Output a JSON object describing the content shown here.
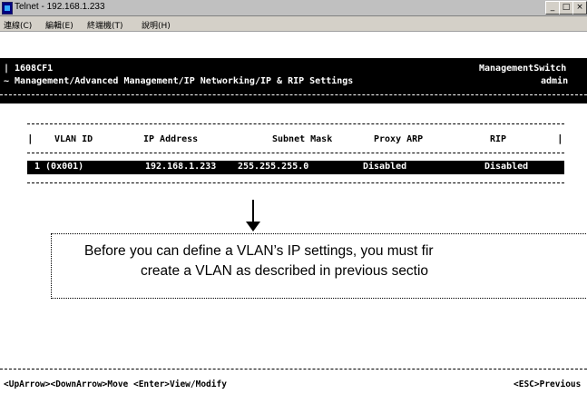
{
  "window": {
    "title": "Telnet - 192.168.1.233",
    "buttons": [
      "_",
      "□",
      "×"
    ]
  },
  "menu": {
    "items": [
      "連線(C)",
      "編輯(E)",
      "終端機(T)",
      "說明(H)"
    ]
  },
  "terminal": {
    "device": "1608CF1",
    "device_type": "ManagementSwitch",
    "breadcrumb": "~ Management/Advanced Management/IP Networking/IP & RIP Settings",
    "user": "admin",
    "columns": [
      "VLAN ID",
      "IP Address",
      "Subnet Mask",
      "Proxy ARP",
      "RIP"
    ],
    "rows": [
      {
        "vlan_id": "1 (0x001)",
        "ip_address": "192.168.1.233",
        "subnet_mask": "255.255.255.0",
        "proxy_arp": "Disabled",
        "rip": "Disabled"
      }
    ],
    "footer_left": "<UpArrow><DownArrow>Move <Enter>View/Modify",
    "footer_right": "<ESC>Previous"
  },
  "callout": {
    "line1": "Before you can define a VLAN’s IP settings, you must fir",
    "line2": "create a VLAN as described in previous sectio"
  }
}
